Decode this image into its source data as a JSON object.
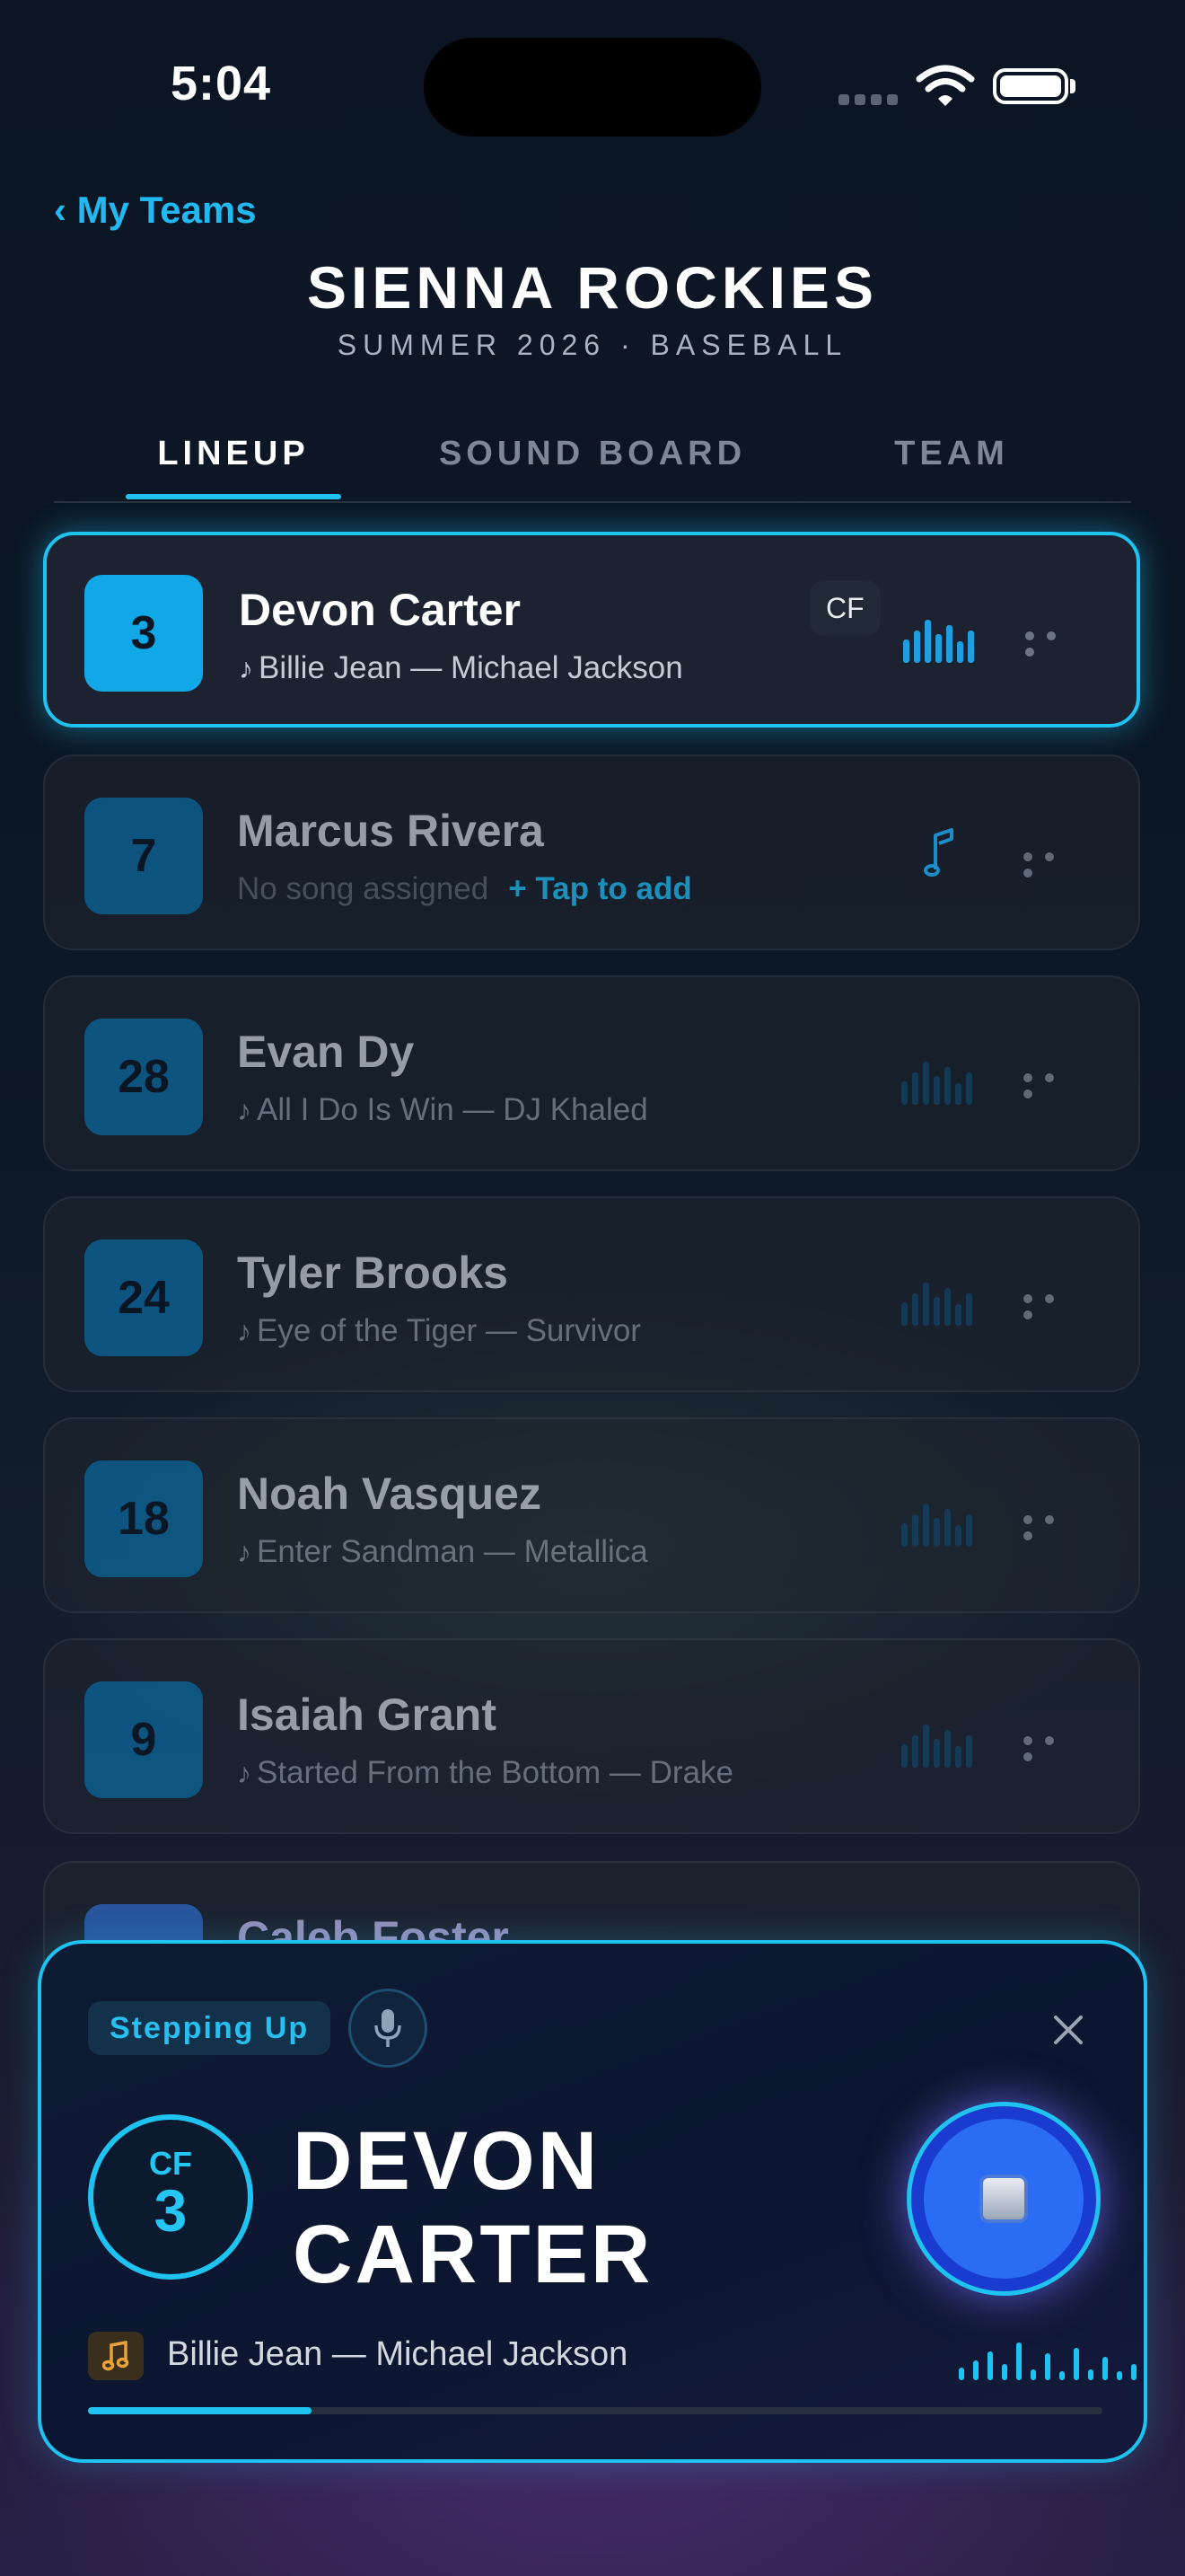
{
  "status_bar": {
    "time": "5:04"
  },
  "header": {
    "back_label": "‹ My Teams",
    "title": "SIENNA ROCKIES",
    "subtitle": "SUMMER 2026 · BASEBALL"
  },
  "tabs": [
    {
      "label": "LINEUP",
      "active": true
    },
    {
      "label": "SOUND BOARD",
      "active": false
    },
    {
      "label": "TEAM",
      "active": false
    }
  ],
  "lineup": [
    {
      "number": "3",
      "name": "Devon Carter",
      "song": "Billie Jean — Michael Jackson",
      "position": "CF",
      "active": true
    },
    {
      "number": "7",
      "name": "Marcus Rivera",
      "no_song": "No song assigned",
      "add_label": "+ Tap to add"
    },
    {
      "number": "28",
      "name": "Evan Dy",
      "song": "All I Do Is Win — DJ Khaled"
    },
    {
      "number": "24",
      "name": "Tyler Brooks",
      "song": "Eye of the Tiger — Survivor"
    },
    {
      "number": "18",
      "name": "Noah Vasquez",
      "song": "Enter Sandman — Metallica"
    },
    {
      "number": "9",
      "name": "Isaiah Grant",
      "song": "Started From the Bottom — Drake"
    },
    {
      "number": "",
      "name": "Caleb Foster"
    }
  ],
  "song_note": "♪",
  "now_playing": {
    "status": "Stepping Up",
    "position": "CF",
    "number": "3",
    "name_line1": "DEVON",
    "name_line2": "CARTER",
    "song": "Billie Jean — Michael Jackson",
    "progress": 0.22
  },
  "colors": {
    "accent": "#1fc3f2",
    "badge": "#11a8e8",
    "stop": "#2b6cf4"
  }
}
